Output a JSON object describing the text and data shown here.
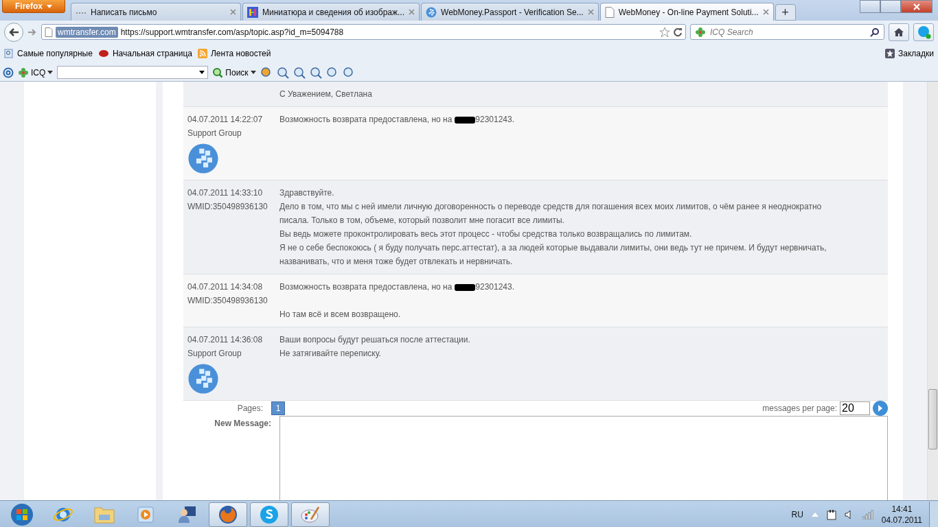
{
  "browser": {
    "app_menu": "Firefox",
    "tabs": [
      {
        "title": "Написать письмо",
        "kind": "dots",
        "selected": false
      },
      {
        "title": "Миниатюра и сведения об изображ...",
        "kind": "colorful",
        "selected": false
      },
      {
        "title": "WebMoney.Passport - Verification Se...",
        "kind": "globe",
        "selected": false
      },
      {
        "title": "WebMoney - On-line Payment Soluti...",
        "kind": "page",
        "selected": true
      }
    ],
    "new_tab": "+",
    "identity": "wmtransfer.com",
    "url": "https://support.wmtransfer.com/asp/topic.asp?id_m=5094788",
    "search_placeholder": "ICQ Search",
    "bookmarks": [
      "Самые популярные",
      "Начальная страница",
      "Лента новостей"
    ],
    "bookmarks_menu": "Закладки",
    "icq_label": "ICQ",
    "search_button": "Поиск"
  },
  "messages": [
    {
      "lines": [
        {
          "kind": "text",
          "text": "С Уважением, Светлана"
        }
      ]
    },
    {
      "date": "04.07.2011 14:22:07",
      "author": "Support Group",
      "avatar": true,
      "lines": [
        {
          "kind": "redacted",
          "before": "Возможность возврата предоставлена, но на",
          "after": "92301243."
        }
      ]
    },
    {
      "date": "04.07.2011 14:33:10",
      "author": "WMID:350498936130",
      "avatar": false,
      "lines": [
        {
          "kind": "text",
          "text": "Здравствуйте."
        },
        {
          "kind": "text",
          "text": "Дело в том, что мы с ней имели личную договоренность о переводе средств для погашения всех моих лимитов, о чём ранее я неоднократно"
        },
        {
          "kind": "text",
          "text": "писала. Только в том, объеме, который позволит мне погасит все лимиты."
        },
        {
          "kind": "text",
          "text": "Вы ведь можете проконтролировать весь этот процесс - чтобы средства только возвращались по лимитам."
        },
        {
          "kind": "text",
          "text": "Я не о себе беспокоюсь ( я буду получать перс.аттестат), а за людей которые выдавали лимиты, они ведь тут не причем. И будут нервничать,"
        },
        {
          "kind": "text",
          "text": "названивать, что и меня тоже будет отвлекать и нервничать."
        }
      ]
    },
    {
      "date": "04.07.2011 14:34:08",
      "author": "WMID:350498936130",
      "avatar": false,
      "lines": [
        {
          "kind": "redacted",
          "before": "Возможность возврата предоставлена, но на",
          "after": "92301243."
        },
        {
          "kind": "gap"
        },
        {
          "kind": "text",
          "text": "Но там всё и всем возвращено."
        }
      ]
    },
    {
      "date": "04.07.2011 14:36:08",
      "author": "Support Group",
      "avatar": true,
      "lines": [
        {
          "kind": "text",
          "text": "Ваши вопросы будут решаться после аттестации."
        },
        {
          "kind": "text",
          "text": "Не затягивайте переписку."
        }
      ]
    }
  ],
  "pager": {
    "label": "Pages:",
    "pages": [
      {
        "label": "1",
        "selected": true
      }
    ],
    "per_page_label": "messages per page:",
    "per_page": "20"
  },
  "new_message": {
    "label": "New Message:"
  },
  "taskbar": {
    "apps": [
      {
        "kind": "ie",
        "active": false
      },
      {
        "kind": "folder",
        "active": false
      },
      {
        "kind": "media",
        "active": false
      },
      {
        "kind": "user",
        "active": false
      },
      {
        "kind": "firefox",
        "active": true
      },
      {
        "kind": "skype",
        "active": true
      },
      {
        "kind": "paint",
        "active": true
      }
    ],
    "language": "RU",
    "time": "14:41",
    "date": "04.07.2011"
  }
}
